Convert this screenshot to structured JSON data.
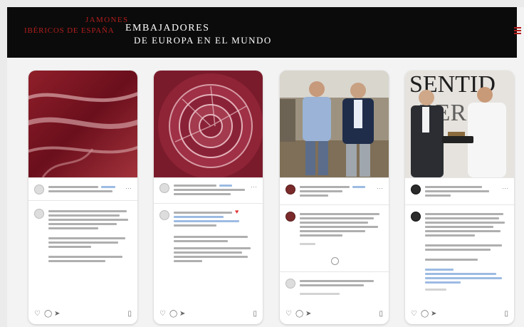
{
  "header": {
    "brand_line1": "JAMONES",
    "brand_line2": "IBÉRICOS DE ESPAÑA",
    "brand_de": "de",
    "slogan_line1": "EMBAJADORES",
    "slogan_line2": "DE EUROPA EN EL MUNDO",
    "menu_icon": "hamburger-icon",
    "brand_color": "#b31d1d"
  },
  "posts": [
    {
      "theme": "sliced-ham",
      "actions": {
        "like": "heart-icon",
        "comment": "comment-icon",
        "share": "share-icon",
        "save": "bookmark-icon"
      }
    },
    {
      "theme": "ham-rosette",
      "actions": {
        "like": "heart-icon",
        "comment": "comment-icon",
        "share": "share-icon",
        "save": "bookmark-icon"
      }
    },
    {
      "theme": "people-photo",
      "actions": {
        "like": "heart-icon",
        "comment": "comment-icon",
        "share": "share-icon",
        "save": "bookmark-icon"
      }
    },
    {
      "theme": "award-photo",
      "actions": {
        "like": "heart-icon",
        "comment": "comment-icon",
        "share": "share-icon",
        "save": "bookmark-icon"
      }
    }
  ]
}
